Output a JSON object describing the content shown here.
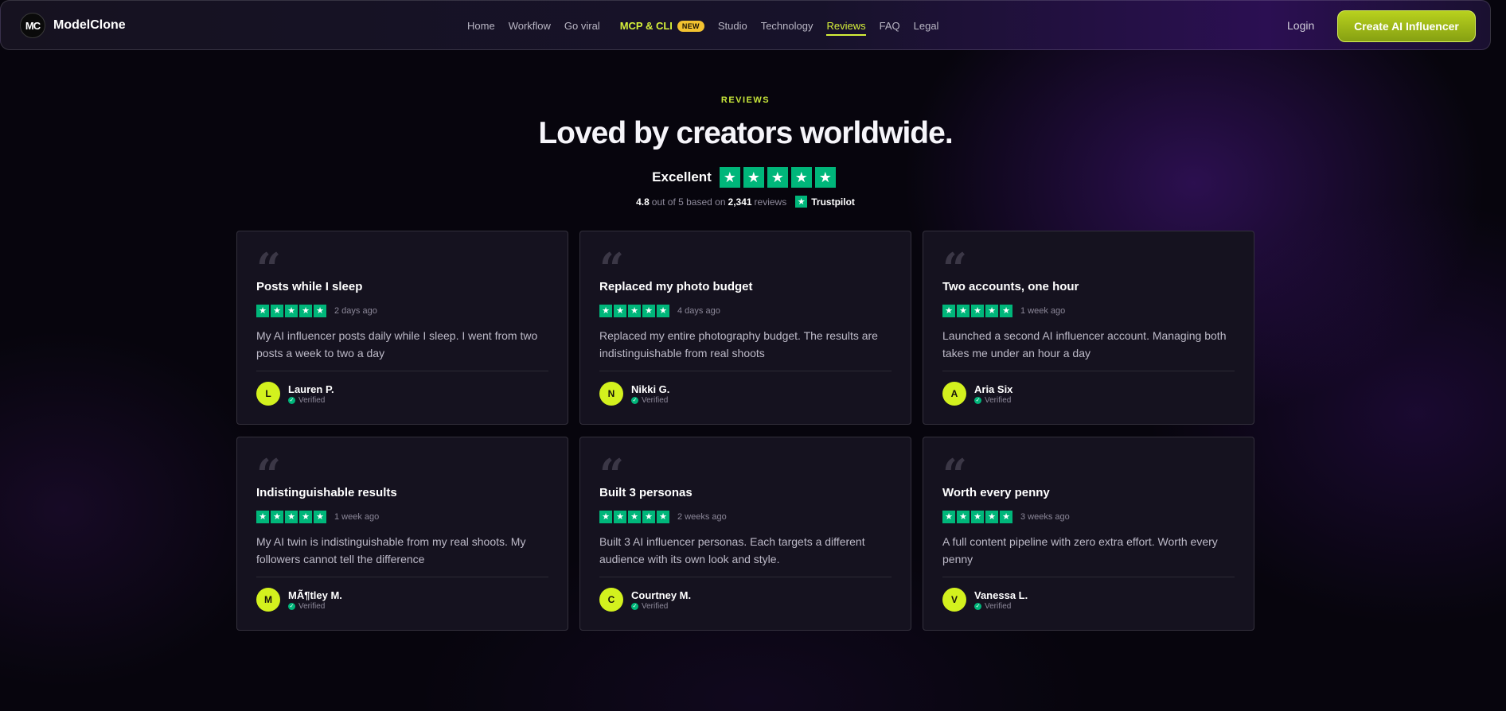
{
  "nav": {
    "brand_mark": "MC",
    "brand_name": "ModelClone",
    "links": [
      "Home",
      "Workflow",
      "Go viral",
      "MCP & CLI",
      "Studio",
      "Technology",
      "Reviews",
      "FAQ",
      "Legal"
    ],
    "mcp_badge": "NEW",
    "active": "Reviews",
    "login": "Login",
    "cta": "Create AI Influencer"
  },
  "hero": {
    "eyebrow": "REVIEWS",
    "title": "Loved by creators worldwide.",
    "rating_word": "Excellent",
    "star_count": 5,
    "score": "4.8",
    "out_of": "out of 5 based on",
    "review_count": "2,341",
    "reviews_word": "reviews",
    "platform": "Trustpilot"
  },
  "colors": {
    "accent": "#d6f03a",
    "trustpilot_green": "#00b67a",
    "background": "#07050d",
    "card": "#15121f"
  },
  "icons": {
    "quote": "quote-icon",
    "star": "star-icon",
    "verified": "check-icon"
  },
  "reviews": [
    {
      "title": "Posts while I sleep",
      "stars": 5,
      "date": "2 days ago",
      "text": "My AI influencer posts daily while I sleep. I went from two posts a week to two a day",
      "initial": "L",
      "name": "Lauren P.",
      "verified": "Verified"
    },
    {
      "title": "Replaced my photo budget",
      "stars": 5,
      "date": "4 days ago",
      "text": "Replaced my entire photography budget. The results are indistinguishable from real shoots",
      "initial": "N",
      "name": "Nikki G.",
      "verified": "Verified"
    },
    {
      "title": "Two accounts, one hour",
      "stars": 5,
      "date": "1 week ago",
      "text": "Launched a second AI influencer account. Managing both takes me under an hour a day",
      "initial": "A",
      "name": "Aria Six",
      "verified": "Verified"
    },
    {
      "title": "Indistinguishable results",
      "stars": 5,
      "date": "1 week ago",
      "text": "My AI twin is indistinguishable from my real shoots. My followers cannot tell the difference",
      "initial": "M",
      "name": "MÃ¶tley M.",
      "verified": "Verified"
    },
    {
      "title": "Built 3 personas",
      "stars": 5,
      "date": "2 weeks ago",
      "text": "Built 3 AI influencer personas. Each targets a different audience with its own look and style.",
      "initial": "C",
      "name": "Courtney M.",
      "verified": "Verified"
    },
    {
      "title": "Worth every penny",
      "stars": 5,
      "date": "3 weeks ago",
      "text": "A full content pipeline with zero extra effort. Worth every penny",
      "initial": "V",
      "name": "Vanessa L.",
      "verified": "Verified"
    }
  ]
}
